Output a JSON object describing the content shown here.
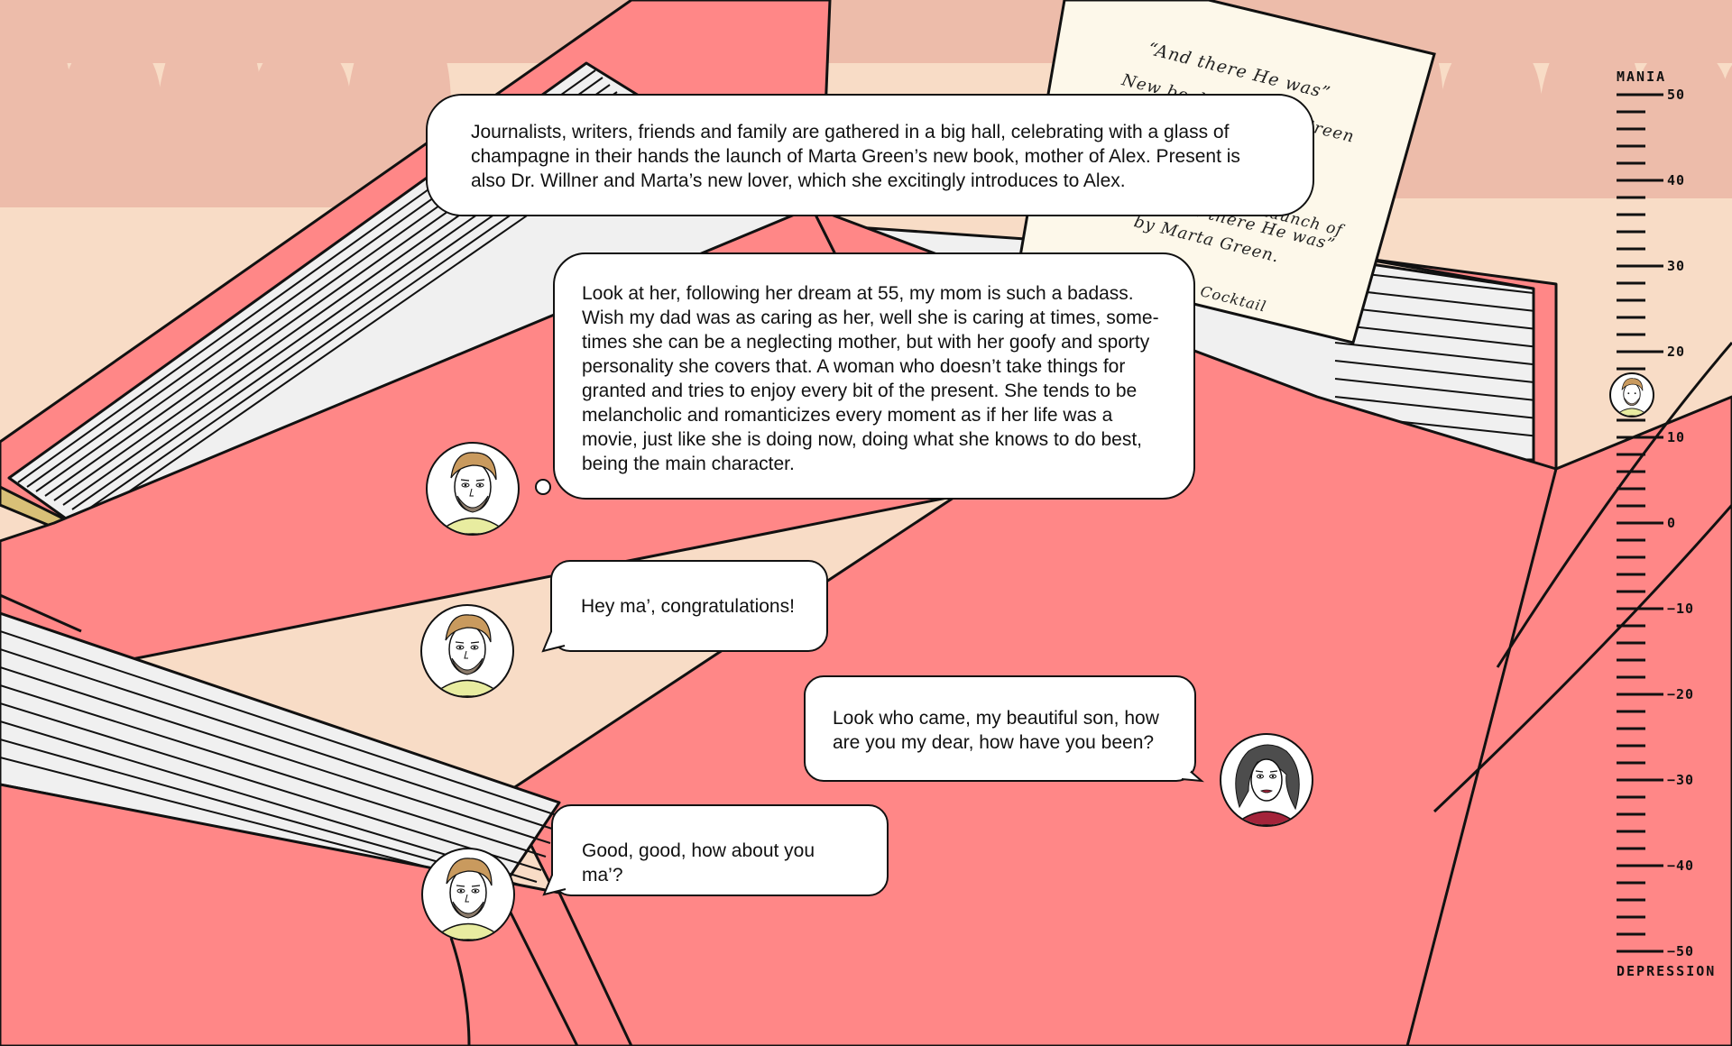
{
  "narration": "Journalists, writers, friends and family are gathered in a big hall, celebrating with a glass of champagne in their hands the launch of Marta Green’s new book, mother of Alex. Present is also Dr. Willner and Marta’s new lover, which she excitingly introduces to Alex.",
  "thought": {
    "speaker": "Alex",
    "text": "Look at her, following her dream at 55, my mom is such a badass. Wish my dad was as caring as her, well she is caring at times, some-times she can be a neglecting mother, but with her goofy and sporty personality she covers that. A woman who doesn’t take things for granted and tries to enjoy every bit of the present. She tends to be melancholic and romanticizes every moment as if her life was a movie, just like she is doing now, doing what she knows to do best, being the main character."
  },
  "dialogue": [
    {
      "speaker": "Alex",
      "text": "Hey ma’, congratulations!"
    },
    {
      "speaker": "Marta",
      "text": "Look who came, my beautiful son, how are you my dear, how have you been?"
    },
    {
      "speaker": "Alex",
      "text": "Good, good, how about you ma’?"
    }
  ],
  "poster": {
    "line1": "“And there He was”",
    "line2": "New book by Marta Green",
    "line3": "Launch of",
    "line4": "“And there He was”",
    "line5": "by Marta Green.",
    "line6": "Cocktail"
  },
  "meter": {
    "top_label": "MANIA",
    "bottom_label": "DEPRESSION",
    "ticks": [
      "50",
      "40",
      "30",
      "20",
      "10",
      "0",
      "−10",
      "−20",
      "−30",
      "−40",
      "−50"
    ],
    "current_value": 15,
    "marker": "alex-avatar"
  },
  "colors": {
    "background": "#f8dcc6",
    "crowd": "#edbcaa",
    "book": "#ff8787",
    "paper": "#fdf8ea",
    "shirt": "#e8eca0"
  }
}
